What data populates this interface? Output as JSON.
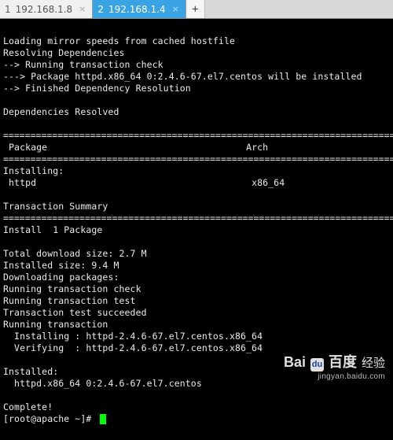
{
  "tabs": {
    "items": [
      {
        "index": "1",
        "title": "192.168.1.8",
        "active": false
      },
      {
        "index": "2",
        "title": "192.168.1.4",
        "active": true
      }
    ],
    "add_label": "+"
  },
  "terminal": {
    "lines_top": [
      "Loading mirror speeds from cached hostfile",
      "Resolving Dependencies",
      "--> Running transaction check",
      "---> Package httpd.x86_64 0:2.4.6-67.el7.centos will be installed",
      "--> Finished Dependency Resolution",
      "",
      "Dependencies Resolved",
      ""
    ],
    "separator": "================================================================================",
    "header_package": " Package",
    "header_arch": "Arch",
    "installing_label": "Installing:",
    "row_package": " httpd",
    "row_arch": "x86_64",
    "summary_label": "Transaction Summary",
    "install_count": "Install  1 Package",
    "lines_mid": [
      "",
      "Total download size: 2.7 M",
      "Installed size: 9.4 M",
      "Downloading packages:",
      "Running transaction check",
      "Running transaction test",
      "Transaction test succeeded",
      "Running transaction",
      "  Installing : httpd-2.4.6-67.el7.centos.x86_64",
      "  Verifying  : httpd-2.4.6-67.el7.centos.x86_64",
      "",
      "Installed:",
      "  httpd.x86_64 0:2.4.6-67.el7.centos",
      "",
      "Complete!"
    ],
    "prompt": "[root@apache ~]# "
  },
  "watermark": {
    "brand_left": "Bai",
    "brand_right": "百度",
    "paw": "du",
    "product": "经验",
    "url": "jingyan.baidu.com"
  }
}
